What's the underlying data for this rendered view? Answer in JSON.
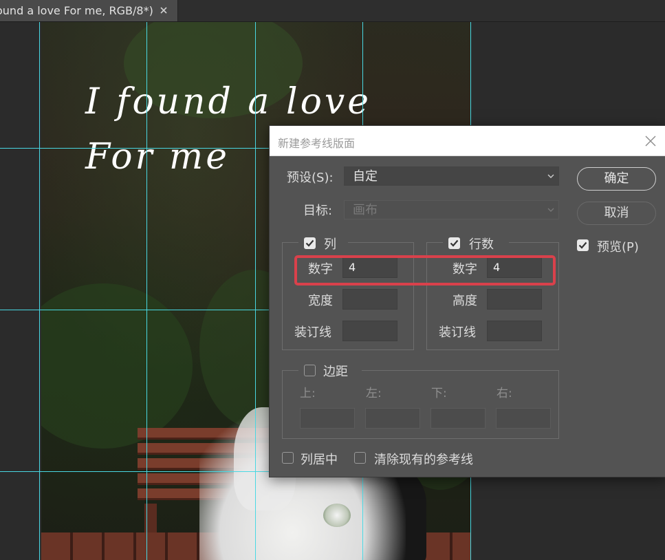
{
  "document_tab": {
    "label": "ound a love For me, RGB/8*)",
    "close_icon": "close-icon"
  },
  "photo": {
    "line1": "I found a love",
    "line2": "For me"
  },
  "dialog": {
    "title": "新建参考线版面",
    "preset_label": "预设(S):",
    "preset_value": "自定",
    "target_label": "目标:",
    "target_value": "画布",
    "ok_label": "确定",
    "cancel_label": "取消",
    "preview_label": "预览(P)",
    "preview_checked": true,
    "columns": {
      "label": "列",
      "checked": true,
      "number_label": "数字",
      "number_value": "4",
      "width_label": "宽度",
      "width_value": "",
      "gutter_label": "装订线",
      "gutter_value": ""
    },
    "rows": {
      "label": "行数",
      "checked": true,
      "number_label": "数字",
      "number_value": "4",
      "height_label": "高度",
      "height_value": "",
      "gutter_label": "装订线",
      "gutter_value": ""
    },
    "margin": {
      "label": "边距",
      "checked": false,
      "top_label": "上:",
      "left_label": "左:",
      "bottom_label": "下:",
      "right_label": "右:"
    },
    "center_columns_label": "列居中",
    "center_columns_checked": false,
    "clear_guides_label": "清除现有的参考线",
    "clear_guides_checked": false
  },
  "colors": {
    "guide": "#49d9e4",
    "highlight": "#d9414b",
    "dialog_bg": "#535353"
  }
}
